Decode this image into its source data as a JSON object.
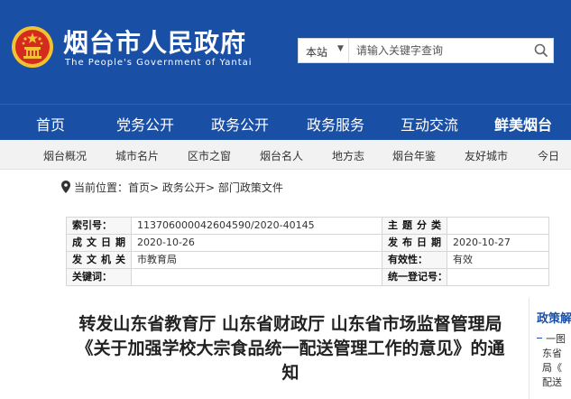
{
  "header": {
    "title": "烟台市人民政府",
    "subtitle": "The People's Government of Yantai",
    "brand_color": "#1a4fa6"
  },
  "search": {
    "scope": "本站",
    "placeholder": "请输入关键字查询"
  },
  "mainnav": {
    "items": [
      "首页",
      "党务公开",
      "政务公开",
      "政务服务",
      "互动交流",
      "鲜美烟台"
    ]
  },
  "subnav": {
    "items": [
      "烟台概况",
      "城市名片",
      "区市之窗",
      "烟台名人",
      "地方志",
      "烟台年鉴",
      "友好城市",
      "今日"
    ]
  },
  "breadcrumb": {
    "label": "当前位置：",
    "items": [
      "首页",
      "政务公开",
      "部门政策文件"
    ],
    "sep": ">"
  },
  "info": {
    "index_label": "索引号：",
    "index_value": "113706000042604590/2020-40145",
    "subject_label": "主题分类",
    "subject_value": "",
    "created_label": "成文日期",
    "created_value": "2020-10-26",
    "published_label": "发布日期",
    "published_value": "2020-10-27",
    "issuer_label": "发文机关",
    "issuer_value": "市教育局",
    "validity_label": "有效性：",
    "validity_value": "有效",
    "keywords_label": "关键词：",
    "keywords_value": "",
    "regnum_label": "统一登记号：",
    "regnum_value": ""
  },
  "article": {
    "title": "转发山东省教育厅 山东省财政厅 山东省市场监督管理局《关于加强学校大宗食品统一配送管理工作的意见》的通知"
  },
  "side": {
    "title": "政策解读",
    "items": [
      "一图",
      "东省",
      "局《",
      "配送"
    ]
  }
}
